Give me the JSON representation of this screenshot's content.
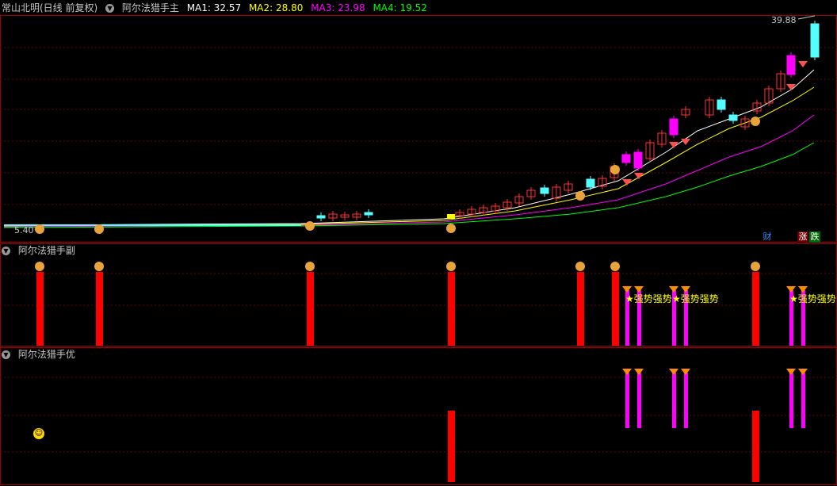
{
  "main_panel": {
    "stock_name": "常山北明(日线 前复权)",
    "indicator_name": "阿尔法猎手主",
    "ma": [
      {
        "label": "MA1: 32.57",
        "color": "#ffffff"
      },
      {
        "label": "MA2: 28.80",
        "color": "#ffff00"
      },
      {
        "label": "MA3: 23.98",
        "color": "#ff00ff"
      },
      {
        "label": "MA4: 19.52",
        "color": "#00ff00"
      }
    ],
    "high_label": "39.88",
    "low_label": "5.40",
    "badges": [
      {
        "text": "财",
        "color": "#3b8cff",
        "bg": "#000000"
      },
      {
        "text": "涨",
        "color": "#ffffff",
        "bg": "#6b0000"
      },
      {
        "text": "跌",
        "color": "#ffffff",
        "bg": "#006b00"
      }
    ]
  },
  "sub_panel_1": {
    "title": "阿尔法猎手副",
    "signal_text": "强势"
  },
  "sub_panel_2": {
    "title": "阿尔法猎手优"
  },
  "colors": {
    "up": "#ff3232",
    "down": "#54ffff",
    "grid": "#6b0000",
    "bar_red": "#ff0000",
    "bar_magenta": "#ff00ff"
  }
}
